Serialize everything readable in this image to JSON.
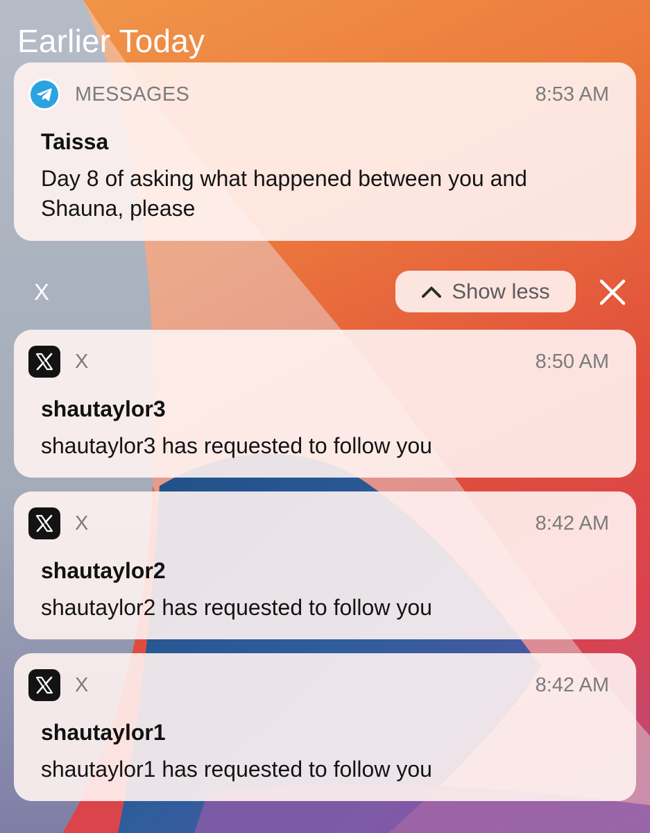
{
  "section_title": "Earlier Today",
  "messages_notification": {
    "app_name": "MESSAGES",
    "time": "8:53 AM",
    "sender": "Taissa",
    "body": "Day 8 of asking what happened between you and Shauna, please",
    "icon": "telegram-icon",
    "icon_color": "#2aa3e0"
  },
  "group": {
    "label": "X",
    "show_less_label": "Show less",
    "show_less_icon": "chevron-up-icon",
    "close_icon": "close-icon"
  },
  "x_notifications": [
    {
      "app_name": "X",
      "time": "8:50 AM",
      "sender": "shautaylor3",
      "body": "shautaylor3 has requested to follow you",
      "icon": "x-logo-icon"
    },
    {
      "app_name": "X",
      "time": "8:42 AM",
      "sender": "shautaylor2",
      "body": "shautaylor2 has requested to follow you",
      "icon": "x-logo-icon"
    },
    {
      "app_name": "X",
      "time": "8:42 AM",
      "sender": "shautaylor1",
      "body": "shautaylor1 has requested to follow you",
      "icon": "x-logo-icon"
    }
  ],
  "colors": {
    "card_background": "#fff3f1",
    "secondary_text": "#7b7b7b",
    "primary_text": "#111111",
    "wallpaper_orange": "#ec7a3c",
    "wallpaper_red": "#e04d3c",
    "wallpaper_blue": "#2f5d9c"
  }
}
